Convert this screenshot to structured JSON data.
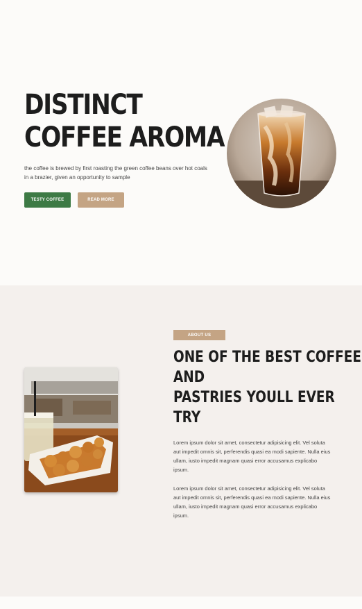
{
  "hero": {
    "title_line1": "DISTINCT",
    "title_line2": "COFFEE AROMA",
    "description": "the coffee is brewed by first roasting the green coffee beans over hot coals in a brazier, given an opportunity to sample",
    "primary_button": "TESTY COFFEE",
    "secondary_button": "READ MORE",
    "image": "iced-coffee-glass"
  },
  "about": {
    "badge": "ABOUT US",
    "title_line1": "ONE OF THE BEST COFFEE",
    "title_line2": "AND",
    "title_line3": "PASTRIES YOULL EVER",
    "title_line4": "TRY",
    "paragraph1": "Lorem ipsum dolor sit amet, consectetur adipisicing elit. Vel soluta aut impedit omnis sit, perferendis quasi ea modi sapiente. Nulla eius ullam, iusto impedit magnam quasi error accusamus explicabo ipsum.",
    "paragraph2": "Lorem ipsum dolor sit amet, consectetur adipisicing elit. Vel soluta aut impedit omnis sit, perferendis quasi ea modi sapiente. Nulla eius ullam, iusto impedit magnam quasi error accusamus explicabo ipsum.",
    "image": "iced-coffee-and-pastries"
  },
  "colors": {
    "accent_green": "#3d7a45",
    "accent_tan": "#c4a484",
    "hero_bg": "#fcfbf9",
    "about_bg": "#f4f0ed"
  }
}
